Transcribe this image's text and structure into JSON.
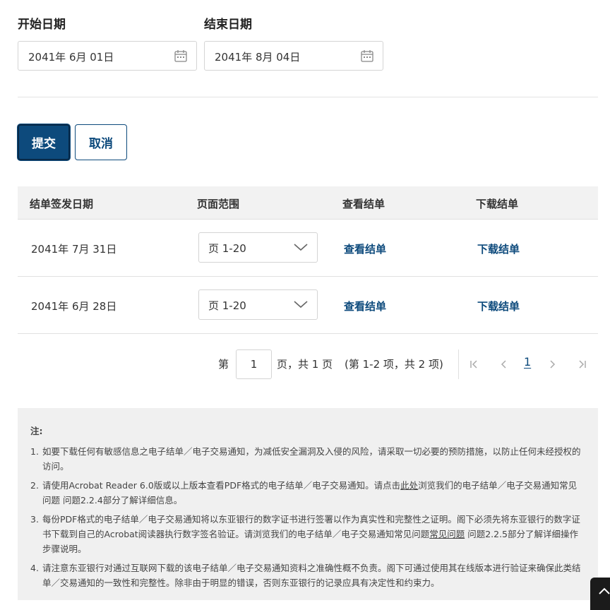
{
  "start_date": {
    "label": "开始日期",
    "value": "2041年 6月 01日",
    "icon": "calendar-icon"
  },
  "end_date": {
    "label": "结束日期",
    "value": "2041年 8月 04日",
    "icon": "calendar-icon"
  },
  "buttons": {
    "submit": "提交",
    "cancel": "取消"
  },
  "table": {
    "headers": [
      "结单签发日期",
      "页面范围",
      "查看结单",
      "下载结单"
    ],
    "rows": [
      {
        "date": "2041年 7月 31日",
        "pages": "页 1-20",
        "view": "查看结单",
        "download": "下载结单"
      },
      {
        "date": "2041年 6月 28日",
        "pages": "页 1-20",
        "view": "查看结单",
        "download": "下载结单"
      }
    ]
  },
  "pagination": {
    "prefix": "第",
    "page_input": "1",
    "suffix": "页，共 1 页",
    "summary": "(第 1-2 项，共 2 项)",
    "current_page": "1"
  },
  "notes": {
    "title": "注:",
    "items": [
      {
        "num": "1.",
        "text": "如要下载任何有敏感信息之电子结单／电子交易通知，为减低安全漏洞及入侵的风险，请采取一切必要的预防措施，以防止任何未经授权的访问。"
      },
      {
        "num": "2.",
        "text_before": "请使用Acrobat Reader 6.0版或以上版本查看PDF格式的电子结单／电子交易通知。请点击",
        "link": "此处",
        "text_after": "浏览我们的电子结单／电子交易通知常见问题 问题2.2.4部分了解详细信息。"
      },
      {
        "num": "3.",
        "text_before": "每份PDF格式的电子结单／电子交易通知将以东亚银行的数字证书进行签署以作为真实性和完整性之证明。阁下必须先将东亚银行的数字证书下载到自己的Acrobat阅读器执行数字签名验证。请浏览我们的电子结单／电子交易通知常见问题",
        "link": "常见问题",
        "text_after": " 问题2.2.5部分了解详细操作步骤说明。"
      },
      {
        "num": "4.",
        "text": "请注意东亚银行对通过互联网下载的该电子结单／电子交易通知资料之准确性概不负责。阁下可通过使用其在线版本进行验证来确保此类结单／交易通知的一致性和完整性。除非由于明显的错误，否则东亚银行的记录应具有决定性和约束力。"
      }
    ]
  },
  "colors": {
    "accent": "#0d4a7c",
    "table_header_bg": "#f2f2f2",
    "notes_bg": "#f0f0f0"
  }
}
